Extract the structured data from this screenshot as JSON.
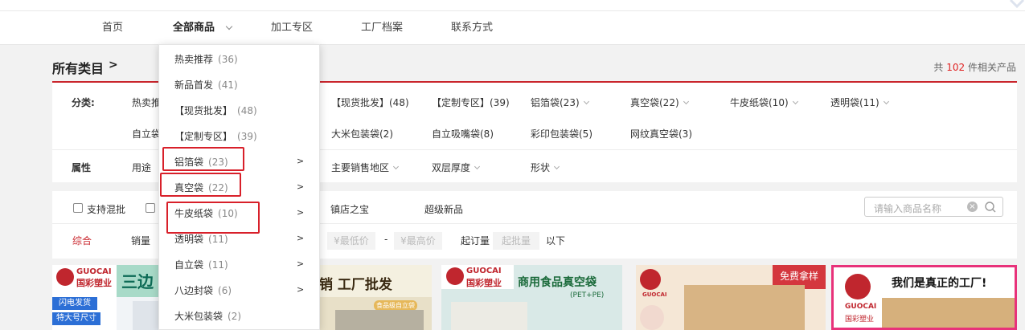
{
  "nav": {
    "items": [
      "首页",
      "全部商品",
      "加工专区",
      "工厂档案",
      "联系方式"
    ]
  },
  "crumb": {
    "title": "所有类目",
    "gt": ">"
  },
  "total": {
    "prefix": "共",
    "count": "102",
    "suffix": "件相关产品"
  },
  "categories": {
    "label": "分类:",
    "row1": [
      "热卖推",
      "【现货批发】(48)",
      "【定制专区】(39)",
      "铝箔袋(23)",
      "真空袋(22)",
      "牛皮纸袋(10)",
      "透明袋(11)"
    ],
    "row2": [
      "自立袋",
      "大米包装袋(2)",
      "自立吸嘴袋(8)",
      "彩印包装袋(5)",
      "网纹真空袋(3)"
    ]
  },
  "attributes": {
    "label": "属性",
    "items": [
      "用途",
      "主要销售地区",
      "双层厚度",
      "形状"
    ]
  },
  "filters": {
    "mixed_batch": "支持混批",
    "treasure": "镇店之宝",
    "super_new": "超级新品",
    "search_placeholder": "请输入商品名称",
    "sort_comprehensive": "综合",
    "sort_sales": "销量",
    "price_min": "¥最低价",
    "dash": "-",
    "price_max": "¥最高价",
    "moq_label": "起订量",
    "moq_placeholder": "起批量",
    "below": "以下"
  },
  "dropdown": [
    {
      "name": "热卖推荐",
      "count": "(36)",
      "arrow": ""
    },
    {
      "name": "新品首发",
      "count": "(41)",
      "arrow": ""
    },
    {
      "name": "【现货批发】",
      "count": "(48)",
      "arrow": ""
    },
    {
      "name": "【定制专区】",
      "count": "(39)",
      "arrow": ""
    },
    {
      "name": "铝箔袋",
      "count": "(23)",
      "arrow": ">"
    },
    {
      "name": "真空袋",
      "count": "(22)",
      "arrow": ">"
    },
    {
      "name": "牛皮纸袋",
      "count": "(10)",
      "arrow": ">"
    },
    {
      "name": "透明袋",
      "count": "(11)",
      "arrow": ">"
    },
    {
      "name": "自立袋",
      "count": "(11)",
      "arrow": ">"
    },
    {
      "name": "八边封袋",
      "count": "(6)",
      "arrow": ">"
    },
    {
      "name": "大米包装袋",
      "count": "(2)",
      "arrow": ""
    }
  ],
  "cards": {
    "c1_brand_en": "GUOCAI",
    "c1_brand_cn": "国彩塑业",
    "c1_headline": "三边",
    "c1_tag1": "闪电发货",
    "c1_tag2": "特大号尺寸",
    "c2_headline": "销 工厂批发",
    "c2_tag": "食品级自立袋",
    "c3_brand_en": "GUOCAI",
    "c3_brand_cn": "国彩塑业",
    "c3_headline": "商用食品真空袋",
    "c3_sub": "(PET+PE)",
    "c4_brand_en": "GUOCAI",
    "c4_badge": "免费拿样",
    "c5_brand_en": "GUOCAI",
    "c5_brand_cn": "国彩塑业",
    "c5_headline": "我们是真正的工厂!"
  },
  "colors": {
    "accent": "#c9252c",
    "highlight": "#d8202a"
  }
}
